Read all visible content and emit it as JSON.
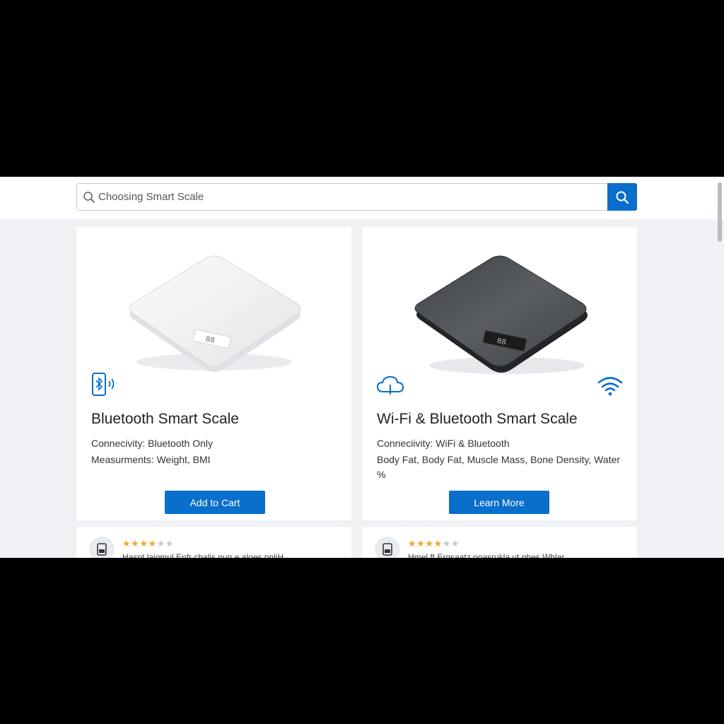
{
  "search": {
    "placeholder": "Choosing Smart Scale",
    "leading_icon": "search-icon",
    "button_icon": "search-icon"
  },
  "colors": {
    "accent": "#0a6ecb",
    "star": "#f2a529",
    "page_bg": "#eff1f4"
  },
  "products": [
    {
      "title": "Bluetooth Smart Scale",
      "icons": [
        "bluetooth-icon"
      ],
      "image": "white-scale-image",
      "image_display": "88",
      "specs": [
        "Connecivity: Bluetooth Only",
        "Measurments: Weight, BMI"
      ],
      "button_label": "Add to Cart"
    },
    {
      "title": "Wi-Fi & Bluetooth Smart Scale",
      "icons": [
        "cloud-icon",
        "wifi-icon"
      ],
      "image": "dark-scale-image",
      "image_display": "88",
      "specs": [
        "Conneciivity: WiFi & Bluetooth",
        "Body Fat, Body Fat, Muscle Mass, Bone Density, Water %"
      ],
      "button_label": "Learn More"
    }
  ],
  "reviews": [
    {
      "avatar_icon": "scale-avatar-icon",
      "stars_filled": 4,
      "stars_total": 6,
      "text": "Hasnt laigmul Enfr cbalis nun e aloes pnliH"
    },
    {
      "avatar_icon": "scale-avatar-icon",
      "stars_filled": 4,
      "stars_total": 6,
      "text": "Hmel ft Ergsaatz onasrukla ut ghes Whlar"
    }
  ]
}
